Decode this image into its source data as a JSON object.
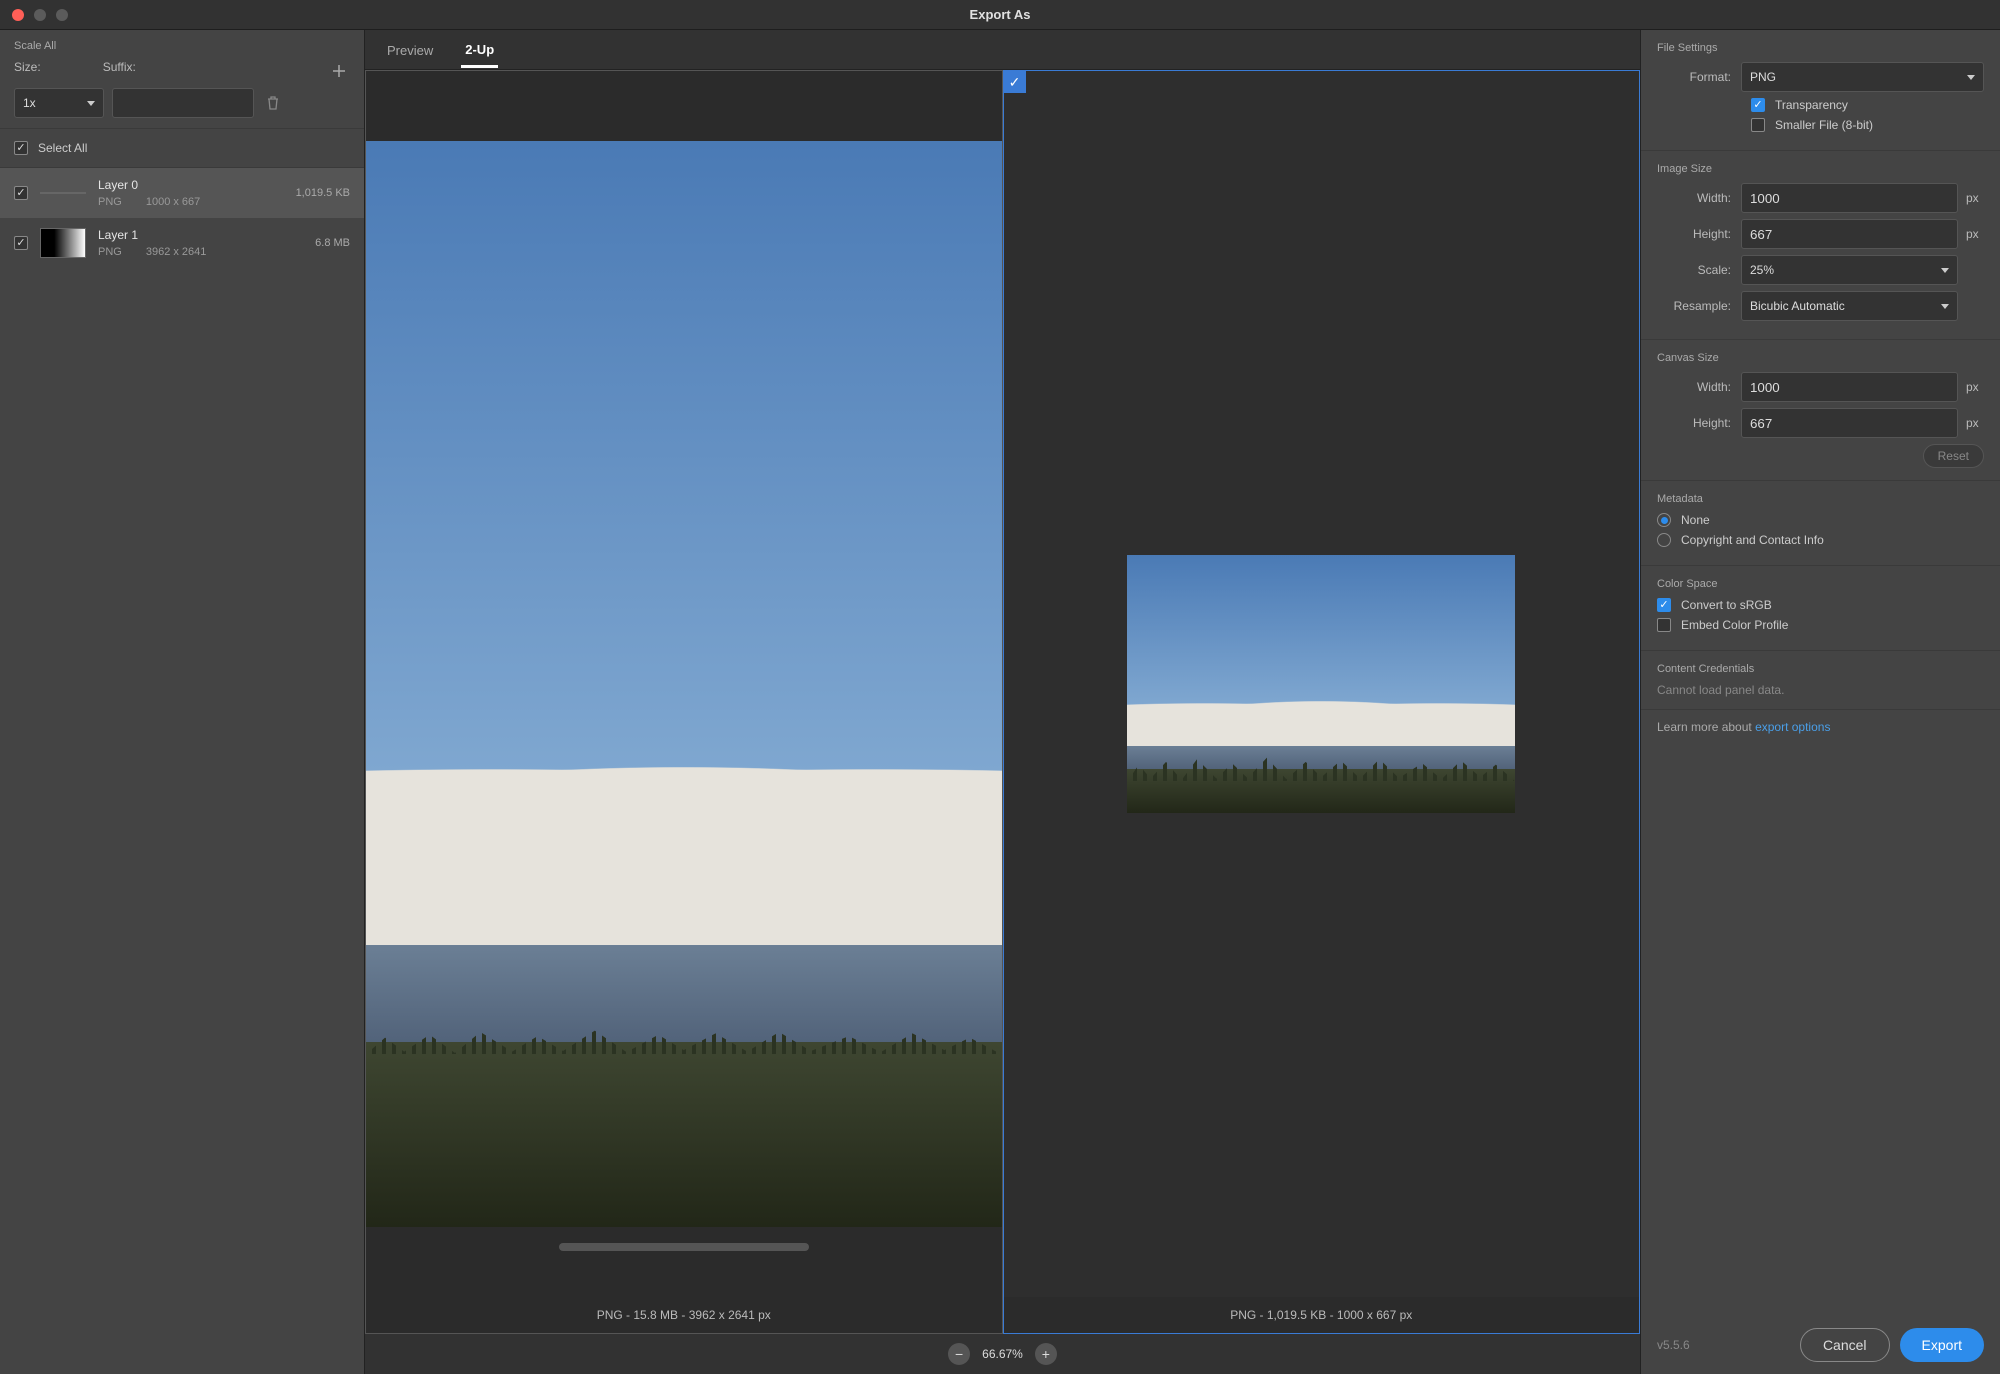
{
  "window": {
    "title": "Export As"
  },
  "leftPanel": {
    "scaleAll": "Scale All",
    "sizeLabel": "Size:",
    "suffixLabel": "Suffix:",
    "sizeValue": "1x",
    "suffixValue": "",
    "selectAll": "Select All",
    "layers": [
      {
        "name": "Layer 0",
        "format": "PNG",
        "dims": "1000 x 667",
        "size": "1,019.5 KB"
      },
      {
        "name": "Layer 1",
        "format": "PNG",
        "dims": "3962 x 2641",
        "size": "6.8 MB"
      }
    ]
  },
  "tabs": {
    "preview": "Preview",
    "twoUp": "2-Up"
  },
  "previewStatus": {
    "left": "PNG - 15.8 MB - 3962 x 2641 px",
    "right": "PNG - 1,019.5 KB - 1000 x 667 px"
  },
  "zoom": {
    "value": "66.67%"
  },
  "rightPanel": {
    "fileSettings": {
      "title": "File Settings",
      "formatLabel": "Format:",
      "formatValue": "PNG",
      "transparency": "Transparency",
      "smallerFile": "Smaller File (8-bit)"
    },
    "imageSize": {
      "title": "Image Size",
      "widthLabel": "Width:",
      "widthValue": "1000",
      "heightLabel": "Height:",
      "heightValue": "667",
      "scaleLabel": "Scale:",
      "scaleValue": "25%",
      "resampleLabel": "Resample:",
      "resampleValue": "Bicubic Automatic",
      "px": "px"
    },
    "canvasSize": {
      "title": "Canvas Size",
      "widthLabel": "Width:",
      "widthValue": "1000",
      "heightLabel": "Height:",
      "heightValue": "667",
      "px": "px",
      "reset": "Reset"
    },
    "metadata": {
      "title": "Metadata",
      "none": "None",
      "copyright": "Copyright and Contact Info"
    },
    "colorSpace": {
      "title": "Color Space",
      "convert": "Convert to sRGB",
      "embed": "Embed Color Profile"
    },
    "contentCredentials": {
      "title": "Content Credentials",
      "msg": "Cannot load panel data."
    },
    "learnMore": "Learn more about ",
    "learnMoreLink": "export options"
  },
  "footer": {
    "version": "v5.5.6",
    "cancel": "Cancel",
    "export": "Export"
  }
}
